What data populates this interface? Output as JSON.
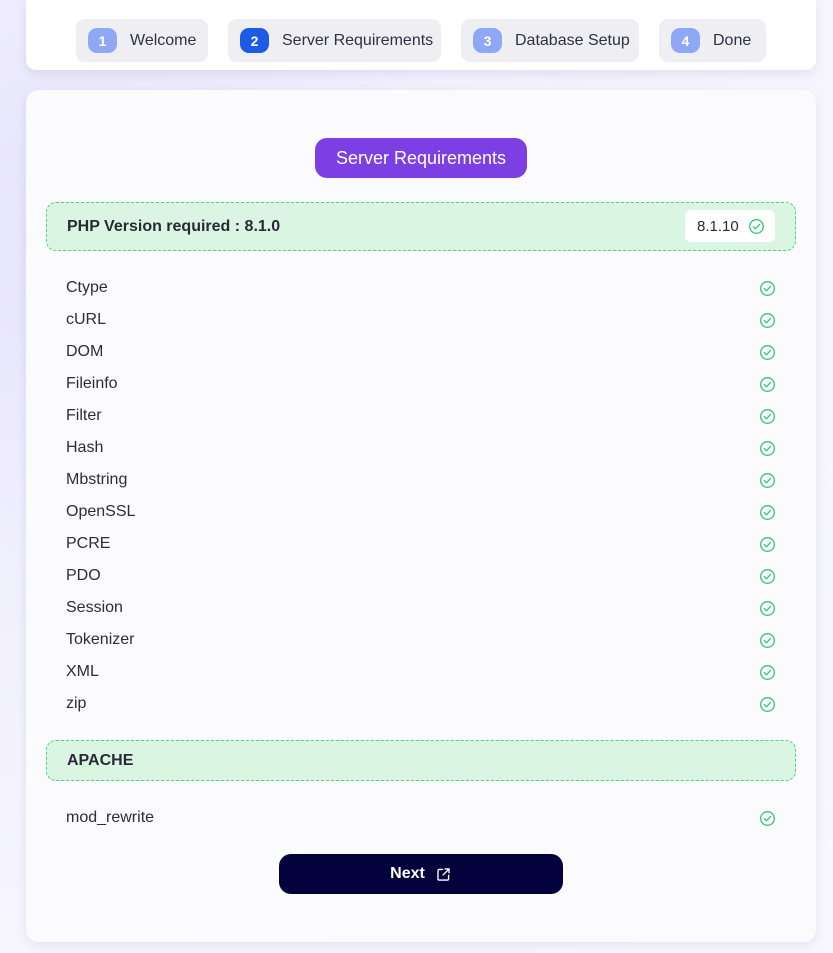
{
  "steps": [
    {
      "number": "1",
      "label": "Welcome"
    },
    {
      "number": "2",
      "label": "Server Requirements"
    },
    {
      "number": "3",
      "label": "Database Setup"
    },
    {
      "number": "4",
      "label": "Done"
    }
  ],
  "active_step": 2,
  "title": "Server Requirements",
  "php": {
    "label": "PHP Version required : 8.1.0",
    "current_version": "8.1.10",
    "status": "ok"
  },
  "extensions": [
    {
      "name": "Ctype",
      "status": "ok"
    },
    {
      "name": "cURL",
      "status": "ok"
    },
    {
      "name": "DOM",
      "status": "ok"
    },
    {
      "name": "Fileinfo",
      "status": "ok"
    },
    {
      "name": "Filter",
      "status": "ok"
    },
    {
      "name": "Hash",
      "status": "ok"
    },
    {
      "name": "Mbstring",
      "status": "ok"
    },
    {
      "name": "OpenSSL",
      "status": "ok"
    },
    {
      "name": "PCRE",
      "status": "ok"
    },
    {
      "name": "PDO",
      "status": "ok"
    },
    {
      "name": "Session",
      "status": "ok"
    },
    {
      "name": "Tokenizer",
      "status": "ok"
    },
    {
      "name": "XML",
      "status": "ok"
    },
    {
      "name": "zip",
      "status": "ok"
    }
  ],
  "apache": {
    "label": "APACHE",
    "modules": [
      {
        "name": "mod_rewrite",
        "status": "ok"
      }
    ]
  },
  "next_button": {
    "label": "Next",
    "icon": "external-link-icon"
  },
  "colors": {
    "accent_purple": "#7b3fe4",
    "step_active": "#1d5ae6",
    "step_inactive": "#8ea8f5",
    "success_green": "#3cc47a",
    "success_bg": "#daf6e3",
    "button_dark": "#03023d"
  },
  "icons": {
    "check": "check-circle-icon"
  }
}
